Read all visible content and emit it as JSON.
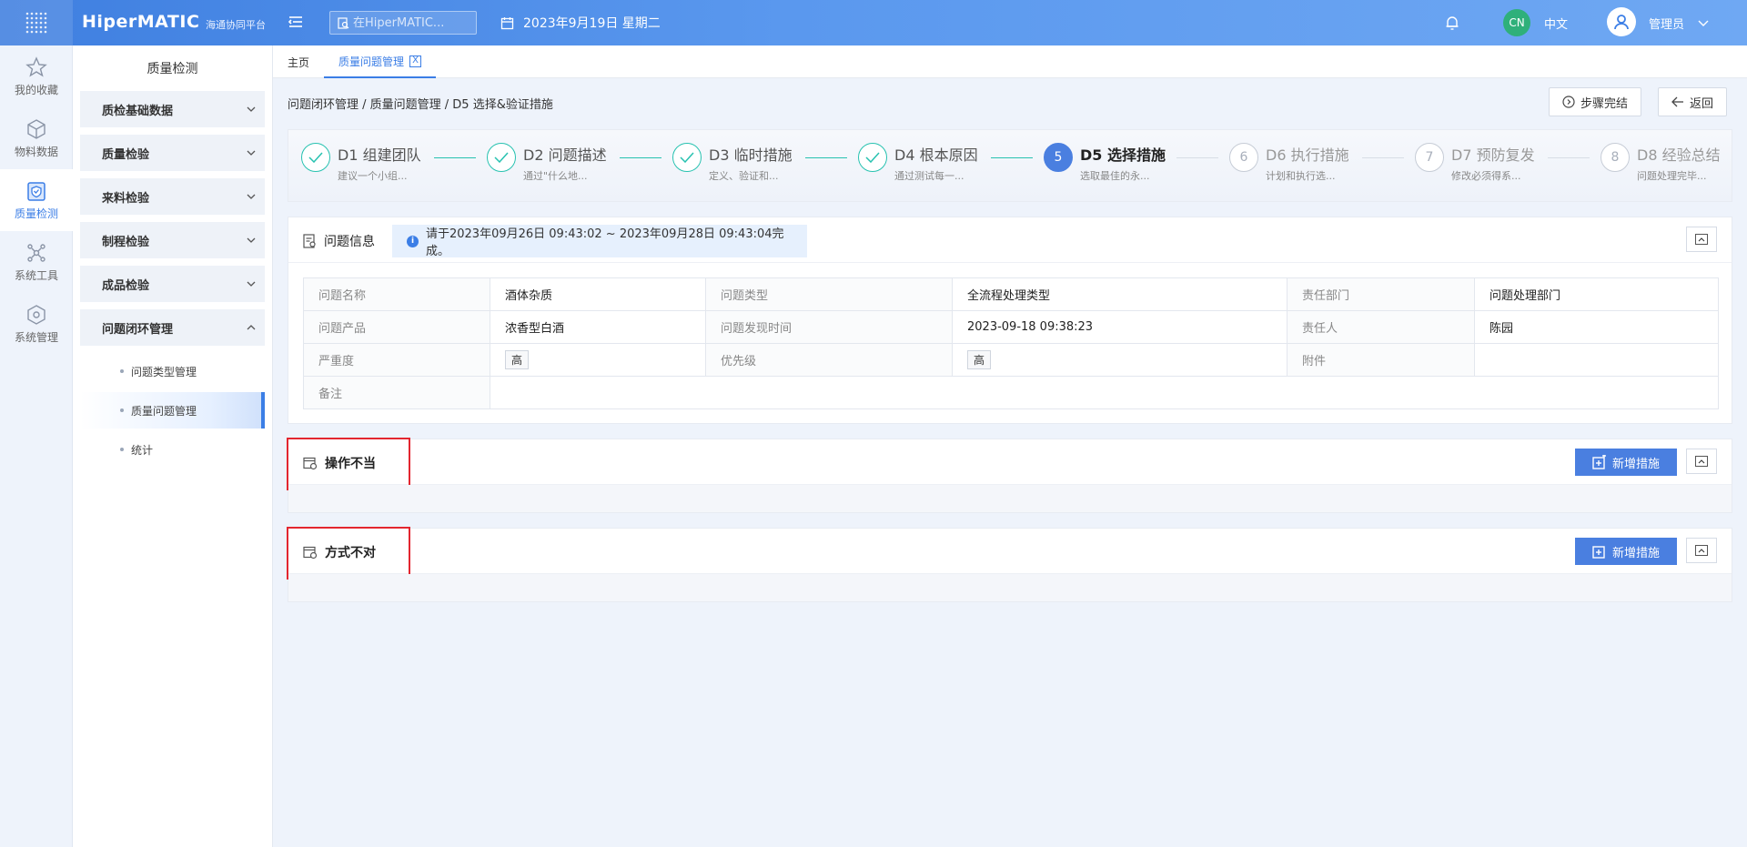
{
  "topbar": {
    "logo": "HiperMATIC",
    "logo_sub": "海通协同平台",
    "search_placeholder": "在HiperMATIC...",
    "date": "2023年9月19日 星期二",
    "lang_badge": "CN",
    "lang_label": "中文",
    "user": "管理员"
  },
  "rail": [
    {
      "label": "我的收藏",
      "icon": "star-icon"
    },
    {
      "label": "物料数据",
      "icon": "cube-icon"
    },
    {
      "label": "质量检测",
      "icon": "shield-check-icon"
    },
    {
      "label": "系统工具",
      "icon": "network-icon"
    },
    {
      "label": "系统管理",
      "icon": "settings-cube-icon"
    }
  ],
  "sidebar": {
    "title": "质量检测",
    "groups": [
      "质检基础数据",
      "质量检验",
      "来料检验",
      "制程检验",
      "成品检验",
      "问题闭环管理"
    ],
    "sub_items": [
      "问题类型管理",
      "质量问题管理",
      "统计"
    ]
  },
  "tabs": {
    "home": "主页",
    "current": "质量问题管理",
    "close": "X"
  },
  "breadcrumb": "问题闭环管理 / 质量问题管理 / D5 选择&验证措施",
  "actions": {
    "complete": "步骤完结",
    "back": "返回"
  },
  "steps": [
    {
      "title": "D1 组建团队",
      "desc": "建议一个小组..."
    },
    {
      "title": "D2 问题描述",
      "desc": "通过\"什么地..."
    },
    {
      "title": "D3 临时措施",
      "desc": "定义、验证和..."
    },
    {
      "title": "D4 根本原因",
      "desc": "通过测试每一..."
    },
    {
      "num": "5",
      "title": "D5 选择措施",
      "desc": "选取最佳的永..."
    },
    {
      "num": "6",
      "title": "D6 执行措施",
      "desc": "计划和执行选..."
    },
    {
      "num": "7",
      "title": "D7 预防复发",
      "desc": "修改必须得系..."
    },
    {
      "num": "8",
      "title": "D8 经验总结",
      "desc": "问题处理完毕..."
    }
  ],
  "info": {
    "title": "问题信息",
    "alert": "请于2023年09月26日 09:43:02 ~ 2023年09月28日 09:43:04完成。",
    "rows": [
      [
        "问题名称",
        "酒体杂质",
        "问题类型",
        "全流程处理类型",
        "责任部门",
        "问题处理部门"
      ],
      [
        "问题产品",
        "浓香型白酒",
        "问题发现时间",
        "2023-09-18 09:38:23",
        "责任人",
        "陈园"
      ],
      [
        "严重度",
        "高",
        "优先级",
        "高",
        "附件",
        ""
      ],
      [
        "备注",
        ""
      ]
    ]
  },
  "measures": [
    {
      "title": "操作不当",
      "button": "新增措施"
    },
    {
      "title": "方式不对",
      "button": "新增措施"
    }
  ],
  "colors": {
    "primary": "#4a7fe0",
    "done": "#27c2b0",
    "highlight": "#e3262f"
  }
}
